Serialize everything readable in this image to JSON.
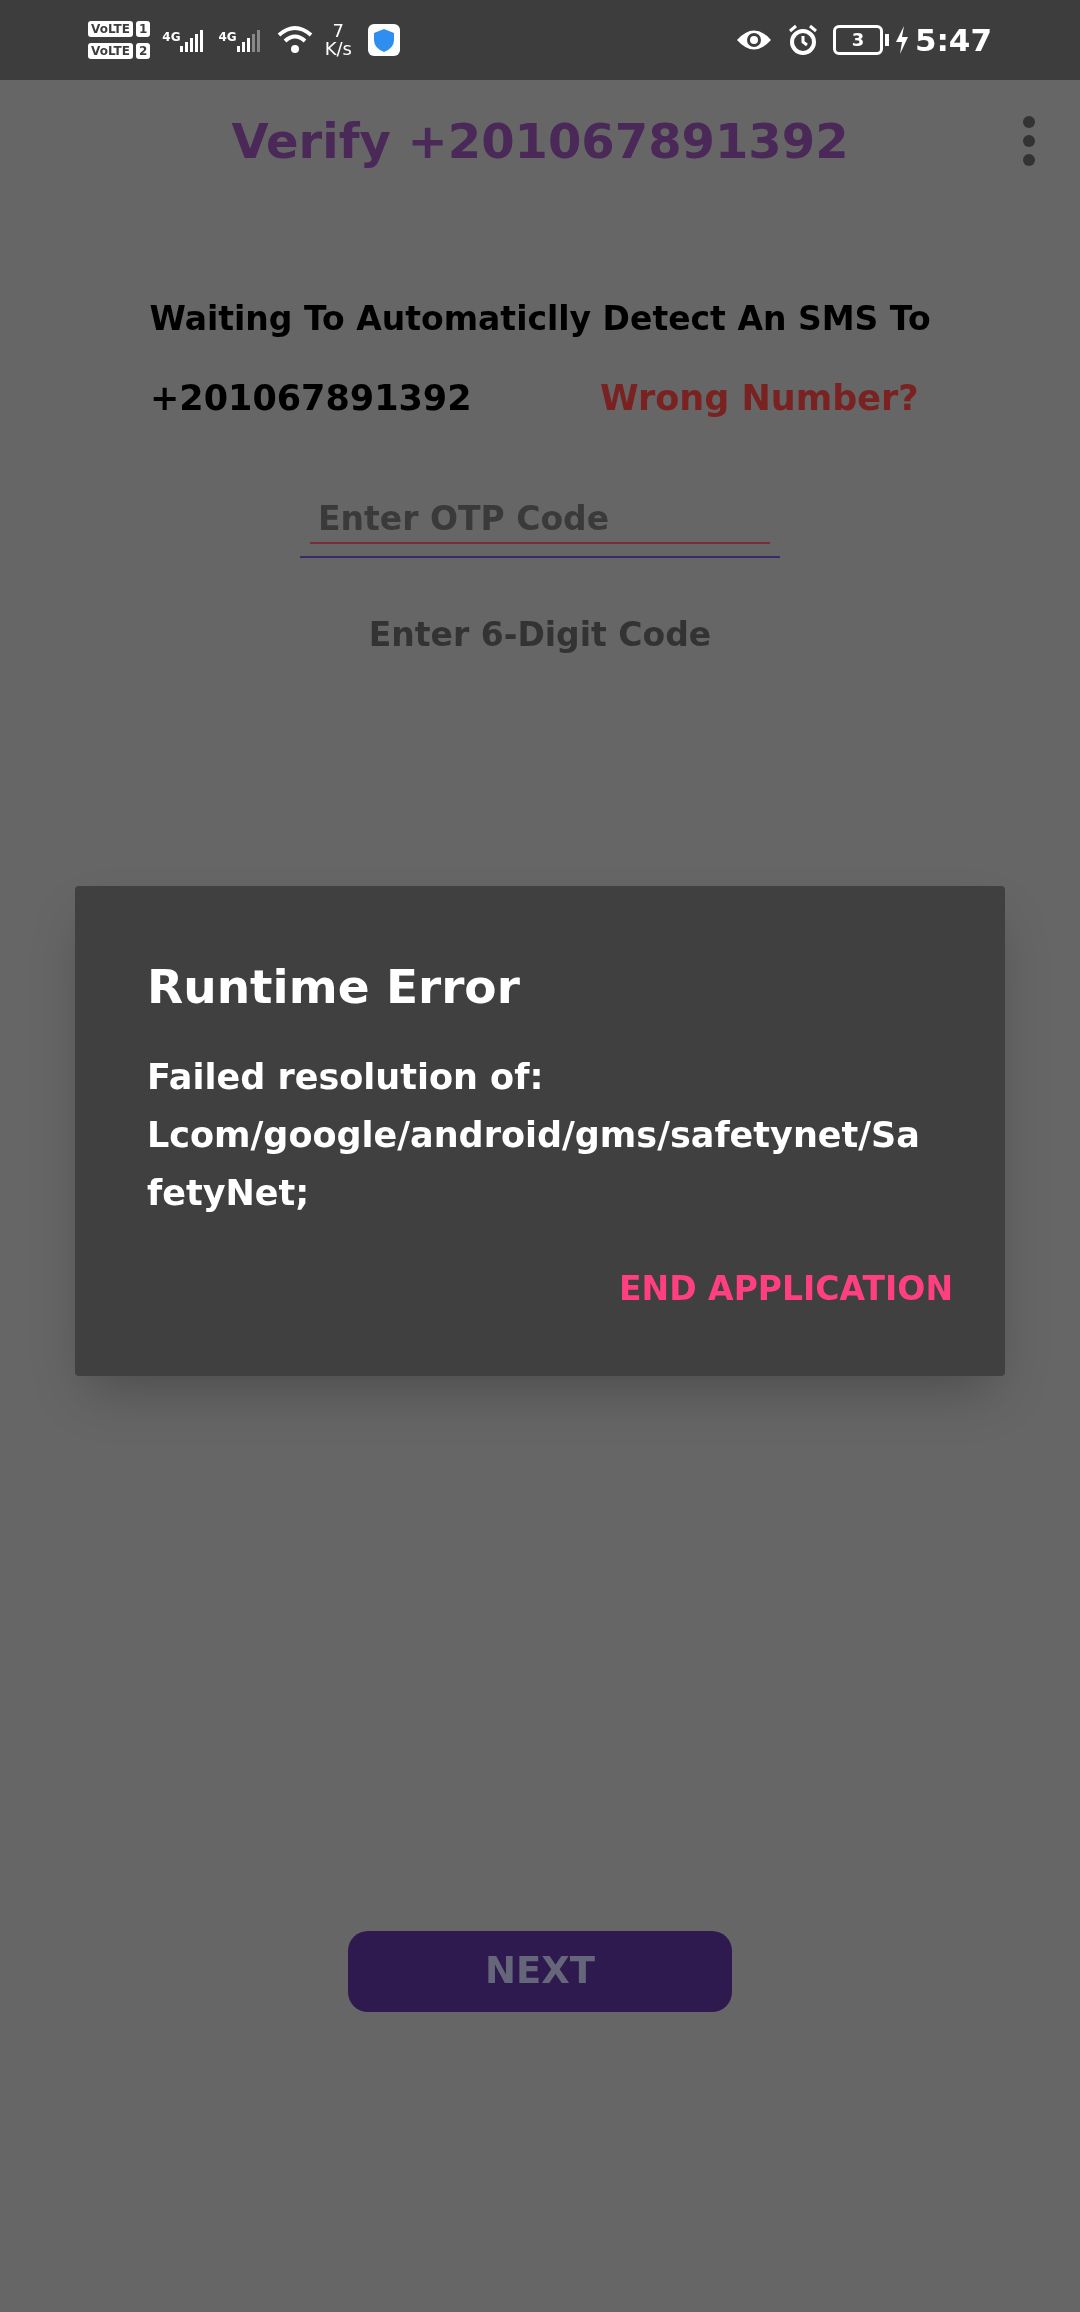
{
  "status_bar": {
    "sims": [
      {
        "tag": "VoLTE",
        "slot": "1"
      },
      {
        "tag": "VoLTE",
        "slot": "2"
      }
    ],
    "networks": [
      "4G",
      "4G"
    ],
    "speed_value": "7",
    "speed_unit": "K/s",
    "battery": "3",
    "time": "5:47"
  },
  "app_bar": {
    "title": "Verify +201067891392"
  },
  "message": {
    "line": "Waiting To Automaticlly Detect An SMS To",
    "phone": "+201067891392",
    "link": "Wrong Number?"
  },
  "otp_field": {
    "placeholder": "Enter OTP Code"
  },
  "hint": "Enter 6-Digit Code",
  "dialog": {
    "title": "Runtime Error",
    "message": "Failed resolution of: Lcom/google/android/gms/safetynet/SafetyNet;",
    "button": "END APPLICATION"
  },
  "next_button": {
    "label": "NEXT"
  }
}
